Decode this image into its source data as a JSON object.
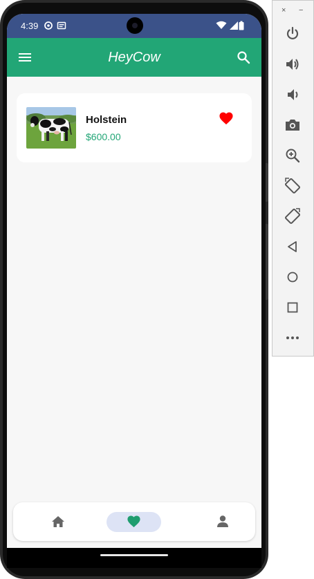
{
  "status_bar": {
    "time": "4:39",
    "icons": [
      "signal-indicator-icon",
      "sim-card-icon",
      "wifi-icon",
      "cellular-icon",
      "battery-icon"
    ]
  },
  "app_bar": {
    "title": "HeyCow",
    "menu_icon": "menu-icon",
    "search_icon": "search-icon"
  },
  "favorites": [
    {
      "name": "Holstein",
      "price": "$600.00",
      "favorited": true,
      "image": "holstein-cow-photo"
    }
  ],
  "bottom_nav": {
    "items": [
      {
        "icon": "home-icon",
        "active": false
      },
      {
        "icon": "heart-icon",
        "active": true
      },
      {
        "icon": "person-icon",
        "active": false
      }
    ]
  },
  "emulator_panel": {
    "close_label": "×",
    "minimize_label": "−",
    "buttons": [
      "power-icon",
      "volume-up-icon",
      "volume-down-icon",
      "camera-icon",
      "zoom-icon",
      "rotate-left-icon",
      "rotate-right-icon",
      "back-icon",
      "home-circle-icon",
      "overview-icon",
      "more-icon"
    ]
  },
  "colors": {
    "status_bar": "#3b5289",
    "app_bar": "#22a676",
    "price": "#22a676",
    "heart": "#ff0000",
    "nav_active_pill": "#dde3f5",
    "nav_active_icon": "#1f9d6f",
    "nav_inactive_icon": "#666666"
  }
}
